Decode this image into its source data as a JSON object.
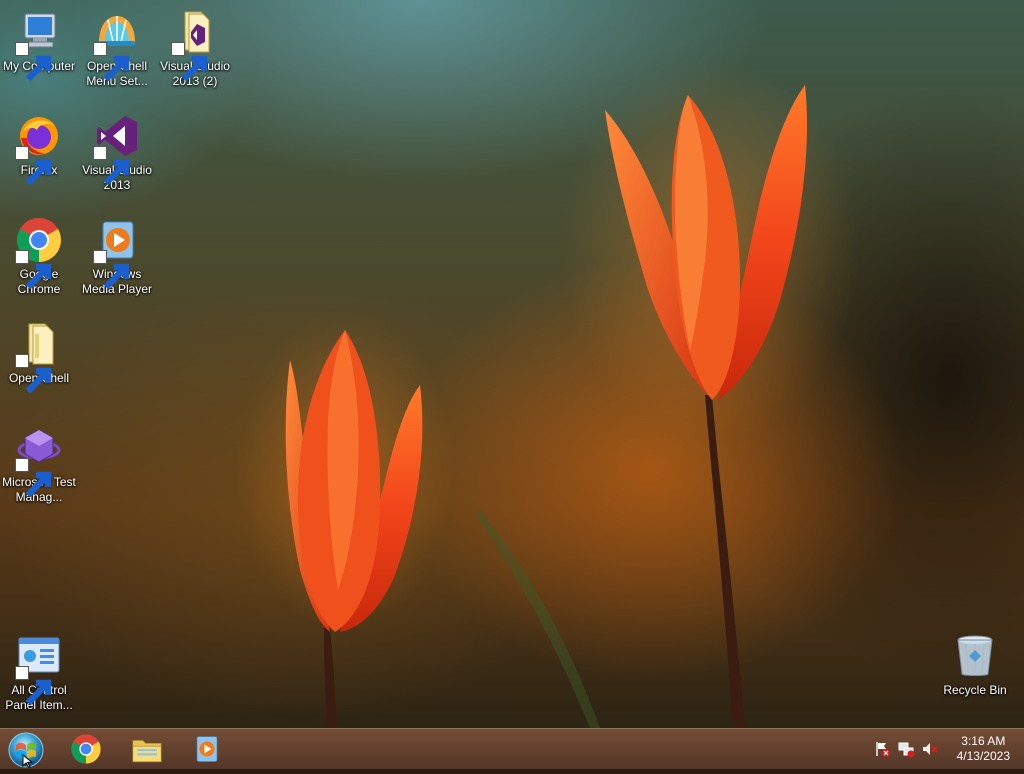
{
  "desktop_icons": {
    "my_computer": "My Computer",
    "open_shell_menu": "Open-Shell Menu Set...",
    "visual_studio_2013_2": "Visual Studio 2013 (2)",
    "firefox": "Firefox",
    "visual_studio_2013": "Visual Studio 2013",
    "google_chrome": "Google Chrome",
    "windows_media_player": "Windows Media Player",
    "open_shell": "Open-Shell",
    "microsoft_test_manager": "Microsoft Test Manag...",
    "all_control_panel": "All Control Panel Item...",
    "recycle_bin": "Recycle Bin"
  },
  "taskbar": {
    "start_icon": "start-orb-icon",
    "pinned": [
      "chrome-icon",
      "file-explorer-icon",
      "media-player-icon"
    ],
    "tray_icons": [
      "action-center-flag-icon",
      "network-icon",
      "volume-muted-icon"
    ],
    "clock_time": "3:16 AM",
    "clock_date": "4/13/2023"
  },
  "colors": {
    "accent": "#e23a12",
    "taskbar": "#6e4a36"
  }
}
